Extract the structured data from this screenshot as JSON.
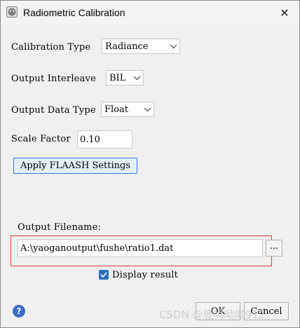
{
  "window": {
    "title": "Radiometric Calibration",
    "close_glyph": "✕"
  },
  "form": {
    "calibration_type": {
      "label": "Calibration Type",
      "value": "Radiance"
    },
    "output_interleave": {
      "label": "Output Interleave",
      "value": "BIL"
    },
    "output_data_type": {
      "label": "Output Data Type",
      "value": "Float"
    },
    "scale_factor": {
      "label": "Scale Factor",
      "value": "0.10"
    },
    "apply_flaash_label": "Apply FLAASH Settings",
    "output_filename": {
      "label": "Output Filename:",
      "value": "A:\\yaoganoutput\\fushe\\ratio1.dat",
      "browse_label": "..."
    },
    "display_result": {
      "label": "Display result",
      "checked": true
    }
  },
  "footer": {
    "help_glyph": "?",
    "ok_label": "OK",
    "cancel_label": "Cancel"
  },
  "watermark": "CSDN @鹿鸣呦呦912",
  "colors": {
    "accent": "#2b6fc2",
    "highlight_box": "#e03a3a",
    "button_border": "#2f7bd6"
  }
}
